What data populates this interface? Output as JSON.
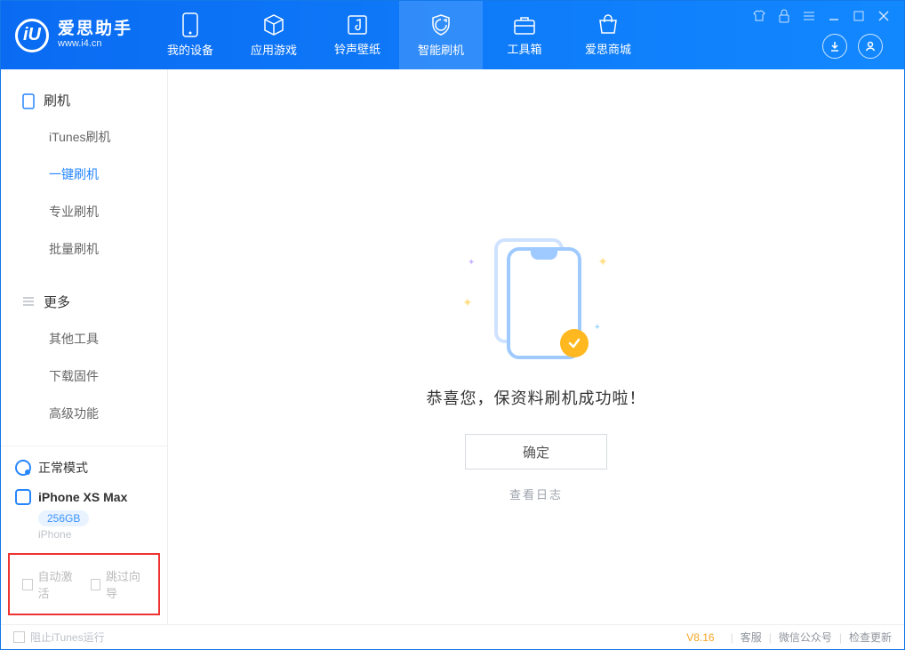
{
  "app": {
    "name": "爱思助手",
    "site": "www.i4.cn"
  },
  "nav": {
    "items": [
      {
        "label": "我的设备"
      },
      {
        "label": "应用游戏"
      },
      {
        "label": "铃声壁纸"
      },
      {
        "label": "智能刷机"
      },
      {
        "label": "工具箱"
      },
      {
        "label": "爱思商城"
      }
    ],
    "active_index": 3
  },
  "sidebar": {
    "groups": [
      {
        "title": "刷机",
        "items": [
          "iTunes刷机",
          "一键刷机",
          "专业刷机",
          "批量刷机"
        ],
        "active_index": 1
      },
      {
        "title": "更多",
        "items": [
          "其他工具",
          "下载固件",
          "高级功能"
        ],
        "active_index": -1
      }
    ],
    "mode": "正常模式",
    "device": {
      "name": "iPhone XS Max",
      "capacity": "256GB",
      "type": "iPhone"
    },
    "bottom_checks": [
      "自动激活",
      "跳过向导"
    ]
  },
  "main": {
    "message": "恭喜您，保资料刷机成功啦！",
    "ok": "确定",
    "log": "查看日志"
  },
  "status": {
    "block_itunes": "阻止iTunes运行",
    "version": "V8.16",
    "links": [
      "客服",
      "微信公众号",
      "检查更新"
    ]
  }
}
